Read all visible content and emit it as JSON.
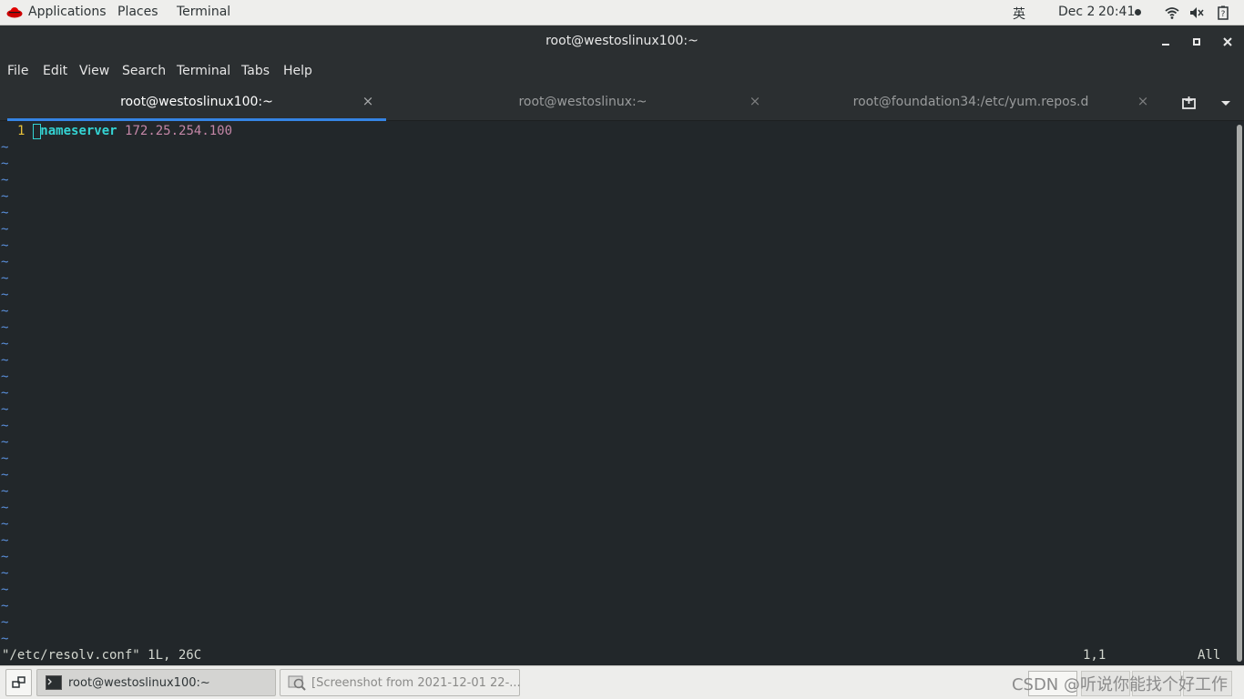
{
  "topbar": {
    "applications": "Applications",
    "places": "Places",
    "terminal": "Terminal",
    "input_method": "英",
    "date": "Dec 2",
    "time": "20:41",
    "icons": [
      "redhat-logo-icon",
      "wifi-icon",
      "volume-icon",
      "battery-icon"
    ]
  },
  "window": {
    "title": "root@westoslinux100:~",
    "buttons": [
      "minimize",
      "maximize",
      "close"
    ]
  },
  "menu": [
    "File",
    "Edit",
    "View",
    "Search",
    "Terminal",
    "Tabs",
    "Help"
  ],
  "tabs": [
    {
      "label": "root@westoslinux100:~",
      "active": true
    },
    {
      "label": "root@westoslinux:~",
      "active": false
    },
    {
      "label": "root@foundation34:/etc/yum.repos.d",
      "active": false
    }
  ],
  "vim": {
    "line1": {
      "number": "1",
      "keyword": "nameserver",
      "value": "172.25.254.100"
    },
    "empty_marker": "~",
    "status_left": "\"/etc/resolv.conf\" 1L, 26C",
    "status_pos": "1,1",
    "status_all": "All"
  },
  "taskbar": {
    "items": [
      {
        "label": "root@westoslinux100:~",
        "active": true
      },
      {
        "label": "[Screenshot from 2021-12-01 22-...",
        "active": false
      }
    ],
    "watermark": "CSDN @听说你能找个好工作"
  },
  "colors": {
    "accent": "#3584e4",
    "keyword": "#34d3d3",
    "ip": "#c386a6",
    "linenum": "#e8c23a",
    "tilde": "#5a8fdb"
  }
}
